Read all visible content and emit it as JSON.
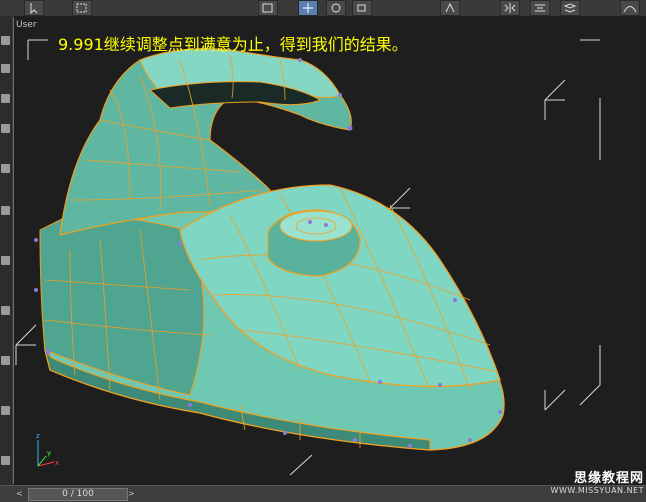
{
  "viewport": {
    "label": "User"
  },
  "caption": "9.991继续调整点到满意为止，得到我们的结果。",
  "timeslider": {
    "value": "0 / 100",
    "prev": "<",
    "next": ">"
  },
  "watermark": {
    "cn": "思缘教程网",
    "url": "WWW.MISSYUAN.NET"
  },
  "axis": {
    "x": "x",
    "y": "y",
    "z": "z"
  },
  "colors": {
    "mesh_fill": "#6fc9b2",
    "mesh_edge": "#f0a020",
    "vertex": "#8b7bd8",
    "gizmo": "#d8d8d8",
    "caption": "#ffff00"
  },
  "toolbar": {
    "icons": [
      "cursor-icon",
      "select-region-icon",
      "move-icon",
      "rotate-icon",
      "scale-icon",
      "snap-icon",
      "mirror-icon",
      "align-icon"
    ]
  }
}
